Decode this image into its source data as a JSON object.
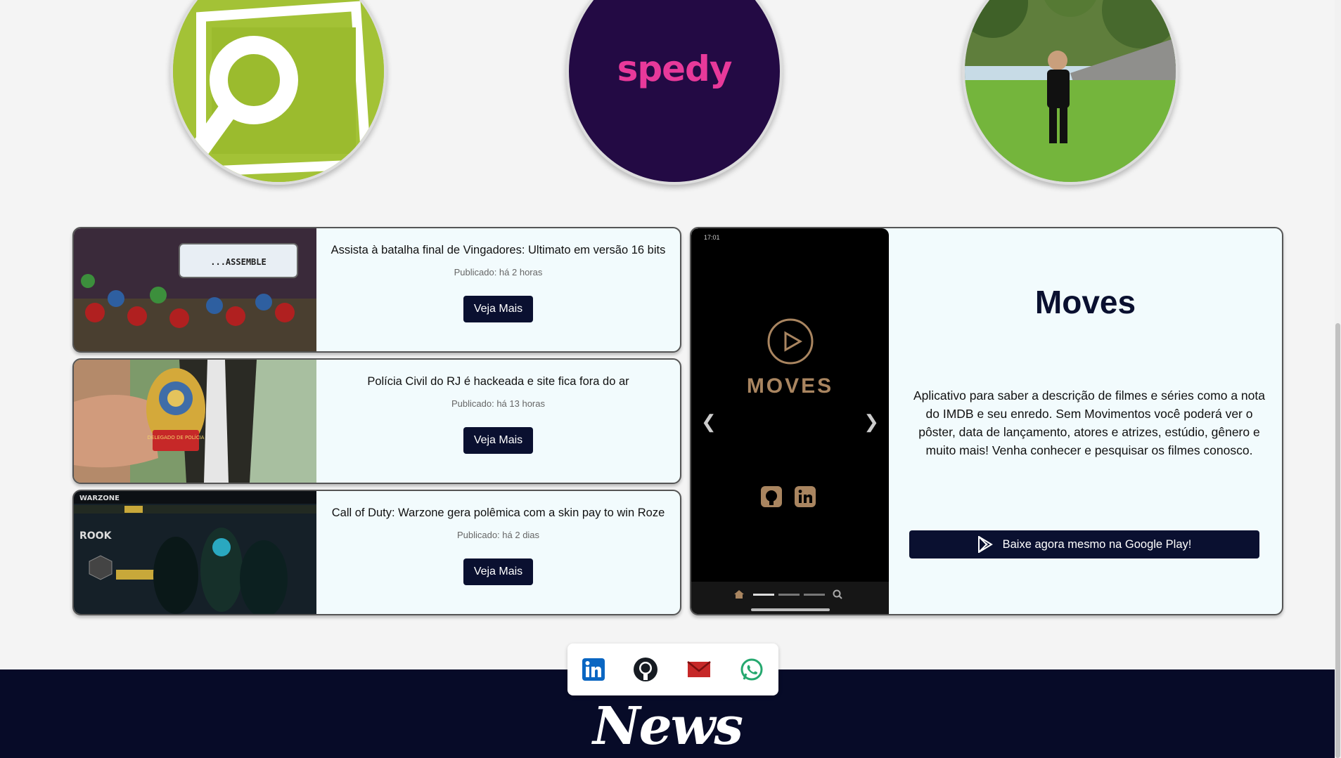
{
  "top_circles": [
    {
      "name": "magnifier-logo"
    },
    {
      "name": "spedy-logo",
      "text": "spedy"
    },
    {
      "name": "profile-photo"
    }
  ],
  "news": [
    {
      "title": "Assista à batalha final de Vingadores: Ultimato em versão 16 bits",
      "date": "Publicado: há 2 horas",
      "button": "Veja Mais",
      "thumb_text": "...ASSEMBLE"
    },
    {
      "title": "Polícia Civil do RJ é hackeada e site fica fora do ar",
      "date": "Publicado: há 13 horas",
      "button": "Veja Mais",
      "thumb_text": "DELEGADO DE POLÍCIA"
    },
    {
      "title": "Call of Duty: Warzone gera polêmica com a skin pay to win Roze",
      "date": "Publicado: há 2 dias",
      "button": "Veja Mais",
      "thumb_text": "ROOK"
    }
  ],
  "project": {
    "title": "Moves",
    "description": "Aplicativo para saber a descrição de filmes e séries como a nota do IMDB e seu enredo. Sem Movimentos você poderá ver o pôster, data de lançamento, atores e atrizes, estúdio, gênero e muito mais! Venha conhecer e pesquisar os filmes conosco.",
    "download_label": "Baixe agora mesmo na Google Play!",
    "phone": {
      "time": "17:01",
      "logo_text": "MOVES"
    }
  },
  "social": [
    "linkedin-icon",
    "github-icon",
    "mail-icon",
    "whatsapp-icon"
  ],
  "footer": {
    "title": "News"
  },
  "colors": {
    "navy": "#0a1030",
    "card_bg": "#f2fbfd",
    "spedy_purple": "#230a44",
    "spedy_pink": "#e8399a",
    "lime": "#a3c236"
  }
}
